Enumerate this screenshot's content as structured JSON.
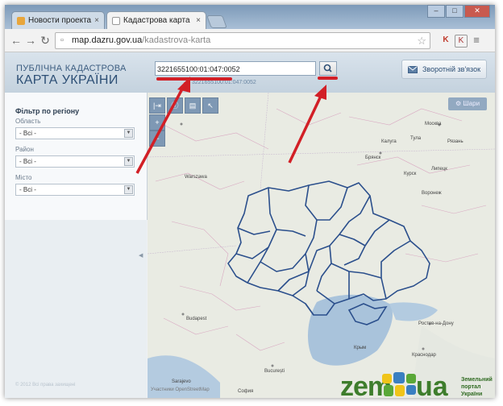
{
  "browser": {
    "tabs": [
      {
        "label": "Новости проекта ZEM.ua",
        "close": "×"
      },
      {
        "label": "Кадастрова карта",
        "close": "×"
      }
    ],
    "url_host": "map.dazru.gov.ua",
    "url_path": "/kadastrova-karta"
  },
  "site": {
    "brand_line1": "ПУБЛІЧНА КАДАСТРОВА",
    "brand_line2": "КАРТА УКРАЇНИ",
    "search_value": "3221655100:01:047:0052",
    "coords_text": "3221655100:01:047:0052",
    "feedback_label": "Зворотній зв'язок"
  },
  "sidebar": {
    "title": "Фільтр по регіону",
    "fields": [
      {
        "label": "Область",
        "value": "- Всі -"
      },
      {
        "label": "Район",
        "value": "- Всі -"
      },
      {
        "label": "Місто",
        "value": "- Всі -"
      }
    ],
    "copyright": "© 2012 Всі права захищені"
  },
  "map": {
    "layers_label": "Шари",
    "labels": {
      "warszawa": "Warszawa",
      "moskva": "Москва",
      "bryansk": "Брянск",
      "budapest": "Budapest",
      "bucuresti": "București",
      "rostov": "Ростов-на-Дону",
      "krasnodar": "Краснодар",
      "sarajevo": "Sarajevo",
      "kursk": "Курск",
      "tula": "Тула",
      "kaluga": "Калуга",
      "ryazan": "Рязань",
      "lipetsk": "Липецк",
      "voronezh": "Воронеж",
      "krym": "Крым",
      "sofia": "София"
    },
    "attribution": "Участники OpenStreetMap"
  },
  "logo": {
    "zem": "zem",
    "ua": "ua",
    "tag_line1": "Земельний",
    "tag_line2": "портал",
    "tag_line3": "України"
  },
  "colors": {
    "annotation": "#d21f26",
    "region_border": "#2b4f8c",
    "header": "#c4d2de",
    "logo_green": "#3e7d2c"
  }
}
